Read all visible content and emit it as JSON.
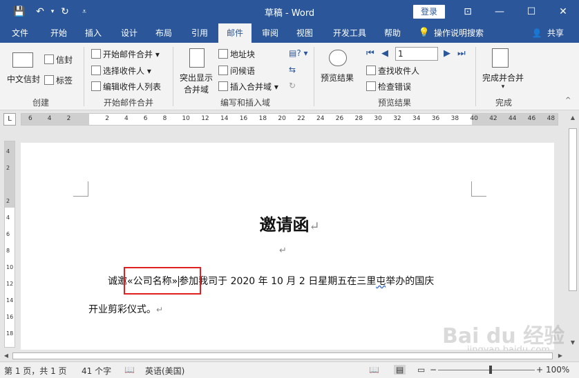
{
  "titlebar": {
    "title": "草稿 - Word",
    "login": "登录",
    "save_glyph": "💾",
    "undo_glyph": "↶",
    "undo_dd": "▾",
    "redo_glyph": "↻",
    "qat_glyph": "⩡",
    "ribbon_display_glyph": "⊡",
    "min_glyph": "—",
    "max_glyph": "☐",
    "close_glyph": "✕",
    "bg_color": "#2b579a"
  },
  "tabs": [
    {
      "label": "文件"
    },
    {
      "label": "开始"
    },
    {
      "label": "插入"
    },
    {
      "label": "设计"
    },
    {
      "label": "布局"
    },
    {
      "label": "引用"
    },
    {
      "label": "邮件",
      "active": true
    },
    {
      "label": "审阅"
    },
    {
      "label": "视图"
    },
    {
      "label": "开发工具"
    },
    {
      "label": "帮助"
    }
  ],
  "tell_me": "操作说明搜索",
  "share": "共享",
  "ribbon": {
    "create": {
      "label": "创建",
      "envelopes": "中文信封",
      "envelope": "信封",
      "labels": "标签"
    },
    "start_merge": {
      "label": "开始邮件合并",
      "start": "开始邮件合并",
      "select_recipients": "选择收件人",
      "edit_list": "编辑收件人列表"
    },
    "write_insert": {
      "label": "编写和插入域",
      "highlight_l1": "突出显示",
      "highlight_l2": "合并域",
      "address_block": "地址块",
      "greeting": "问候语",
      "insert_field": "插入合并域"
    },
    "preview": {
      "label": "预览结果",
      "preview_results": "预览结果",
      "record": "1",
      "find_recipient": "查找收件人",
      "check_errors": "检查错误"
    },
    "finish": {
      "label": "完成",
      "finish_merge": "完成并合并"
    }
  },
  "ruler": {
    "tab_selector": "L",
    "numbers": [
      "6",
      "4",
      "2",
      "",
      "2",
      "4",
      "6",
      "8",
      "10",
      "12",
      "14",
      "16",
      "18",
      "20",
      "22",
      "24",
      "26",
      "28",
      "30",
      "32",
      "34",
      "36",
      "38",
      "40",
      "42",
      "44",
      "46",
      "48"
    ],
    "vnumbers": [
      "4",
      "2",
      "",
      "2",
      "4",
      "6",
      "8",
      "10",
      "12",
      "14",
      "16",
      "18"
    ]
  },
  "document": {
    "title": "邀请函",
    "para_mark": "↵",
    "line1_pre": "诚邀",
    "line1_field": "«公司名称»",
    "line1_post_a": "参加我司于 2020 年 10 月 2 日星期五在三里",
    "line1_wavy": "屯",
    "line1_post_b": "举办的国庆",
    "line2": "开业剪彩仪式。"
  },
  "status": {
    "page": "第 1 页，共 1 页",
    "words": "41 个字",
    "lang": "英语(美国)",
    "zoom": "100%",
    "zoom_minus": "−",
    "zoom_plus": "+"
  },
  "watermark": {
    "main": "Bai du 经验",
    "sub": "jingyan.baidu.com"
  }
}
